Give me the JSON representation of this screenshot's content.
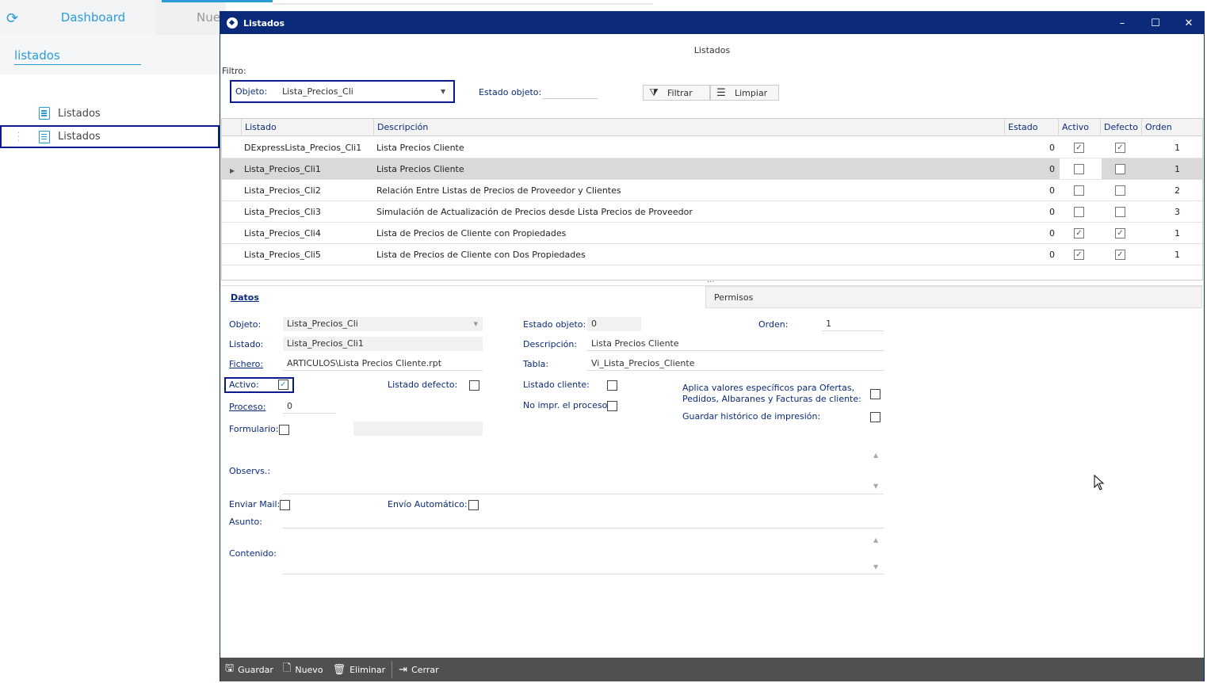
{
  "bg_app": {
    "tab_dashboard": "Dashboard",
    "tab_nue": "Nue",
    "search_value": "listados",
    "side_items": [
      "Listados",
      "Listados"
    ]
  },
  "window": {
    "title": "Listados",
    "subtitle": "Listados",
    "minimize": "–",
    "maximize": "☐",
    "close": "✕"
  },
  "filter": {
    "label": "Filtro:",
    "objeto_label": "Objeto:",
    "objeto_value": "Lista_Precios_Cli",
    "estado_label": "Estado objeto:",
    "estado_value": "",
    "btn_filtrar": "Filtrar",
    "btn_limpiar": "Limpiar"
  },
  "grid": {
    "headers": [
      "Listado",
      "Descripción",
      "Estado",
      "Activo",
      "Defecto",
      "Orden"
    ],
    "rows": [
      {
        "listado": "DExpressLista_Precios_Cli1",
        "descripcion": "Lista Precios Cliente",
        "estado": "0",
        "activo": true,
        "defecto": true,
        "orden": "1"
      },
      {
        "listado": "Lista_Precios_Cli1",
        "descripcion": "Lista Precios Cliente",
        "estado": "0",
        "activo": false,
        "defecto": false,
        "orden": "1"
      },
      {
        "listado": "Lista_Precios_Cli2",
        "descripcion": "Relación Entre Listas de Precios de Proveedor y Clientes",
        "estado": "0",
        "activo": false,
        "defecto": false,
        "orden": "2"
      },
      {
        "listado": "Lista_Precios_Cli3",
        "descripcion": "Simulación de Actualización de Precios desde Lista Precios de Proveedor",
        "estado": "0",
        "activo": false,
        "defecto": false,
        "orden": "3"
      },
      {
        "listado": "Lista_Precios_Cli4",
        "descripcion": "Lista de Precios de Cliente con Propiedades",
        "estado": "0",
        "activo": true,
        "defecto": true,
        "orden": "1"
      },
      {
        "listado": "Lista_Precios_Cli5",
        "descripcion": "Lista de Precios de Cliente con  Dos Propiedades",
        "estado": "0",
        "activo": true,
        "defecto": true,
        "orden": "1"
      }
    ]
  },
  "tabs": {
    "datos": "Datos",
    "permisos": "Permisos"
  },
  "form": {
    "objeto_label": "Objeto:",
    "objeto_value": "Lista_Precios_Cli",
    "listado_label": "Listado:",
    "listado_value": "Lista_Precios_Cli1",
    "fichero_label": "Fichero:",
    "fichero_value": "ARTICULOS\\Lista Precios Cliente.rpt",
    "activo_label": "Activo:",
    "listado_defecto_label": "Listado defecto:",
    "proceso_label": "Proceso:",
    "proceso_value": "0",
    "formulario_label": "Formulario:",
    "estado_objeto_label": "Estado objeto:",
    "estado_objeto_value": "0",
    "orden_label": "Orden:",
    "orden_value": "1",
    "descripcion_label": "Descripción:",
    "descripcion_value": "Lista Precios Cliente",
    "tabla_label": "Tabla:",
    "tabla_value": "Vi_Lista_Precios_Cliente",
    "listado_cliente_label": "Listado cliente:",
    "no_impr_label": "No impr. el proceso",
    "aplica_label_1": "Aplica valores específicos para Ofertas,",
    "aplica_label_2": "Pedidos, Albaranes y Facturas de cliente:",
    "guardar_hist_label": "Guardar histórico de impresión:",
    "observs_label": "Observs.:",
    "enviar_mail_label": "Enviar Mail:",
    "envio_auto_label": "Envío Automático:",
    "asunto_label": "Asunto:",
    "contenido_label": "Contenido:"
  },
  "bottom": {
    "guardar": "Guardar",
    "nuevo": "Nuevo",
    "eliminar": "Eliminar",
    "cerrar": "Cerrar"
  }
}
